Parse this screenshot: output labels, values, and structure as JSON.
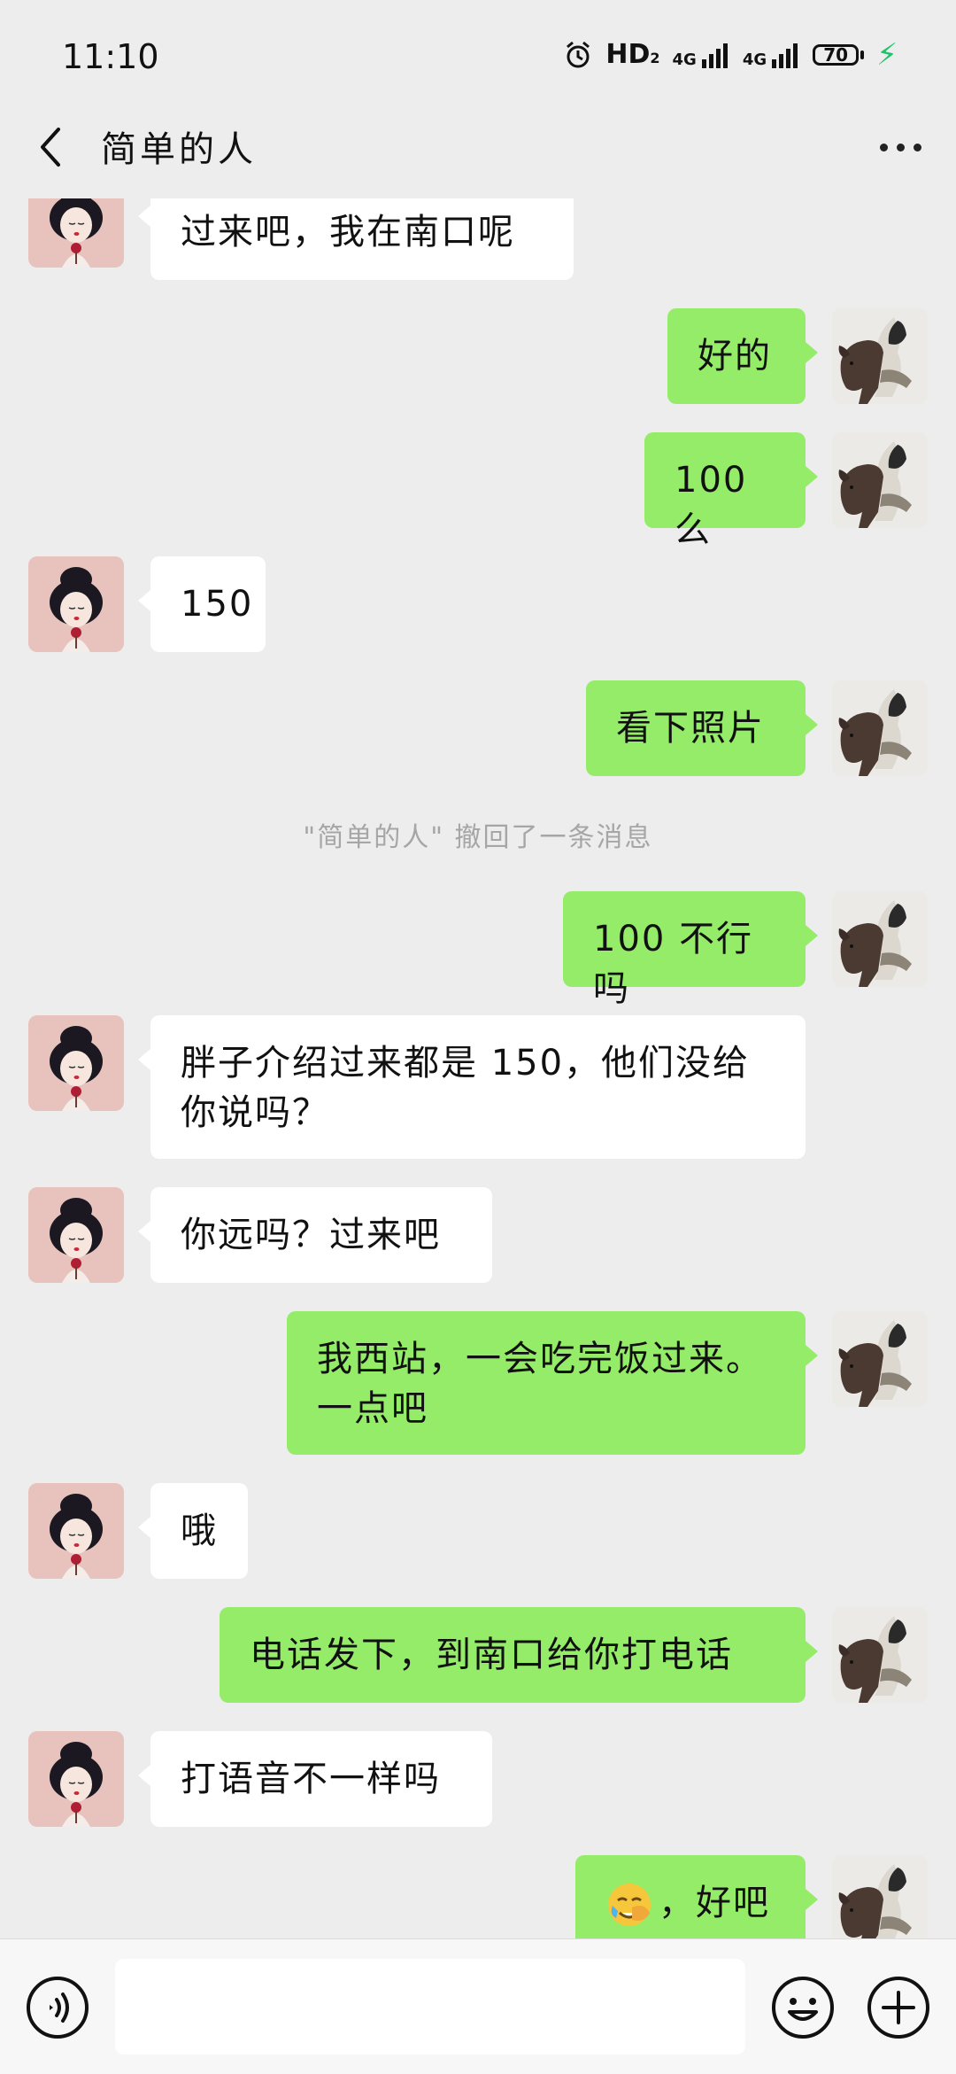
{
  "status_bar": {
    "time": "11:10",
    "hd_label": "HD",
    "hd_sub": "2",
    "network_1": "4G",
    "network_2": "4G",
    "battery_level": "70",
    "charging": true,
    "icons": [
      "alarm-icon",
      "signal-icon",
      "battery-icon",
      "charge-icon"
    ]
  },
  "header": {
    "title": "简单的人",
    "back_icon": "chevron-left-icon",
    "more_icon": "more-dots-icon"
  },
  "messages": [
    {
      "side": "in",
      "text": "过来吧，我在南口呢"
    },
    {
      "side": "out",
      "text": "好的"
    },
    {
      "side": "out",
      "text": "100 么"
    },
    {
      "side": "in",
      "text": "150"
    },
    {
      "side": "out",
      "text": "看下照片"
    },
    {
      "side": "system",
      "text": "\"简单的人\" 撤回了一条消息"
    },
    {
      "side": "out",
      "text": "100 不行吗"
    },
    {
      "side": "in",
      "line1": "胖子介绍过来都是 150，他们没给",
      "line2": "你说吗？"
    },
    {
      "side": "in",
      "text": "你远吗？过来吧"
    },
    {
      "side": "out",
      "line1": "我西站，一会吃完饭过来。",
      "line2": "一点吧"
    },
    {
      "side": "in",
      "text": "哦"
    },
    {
      "side": "out",
      "text": "电话发下，到南口给你打电话"
    },
    {
      "side": "in",
      "text": "打语音不一样吗"
    },
    {
      "side": "out",
      "emoji": "facepalm-crying-emoji",
      "text": "，好吧"
    }
  ],
  "input_bar": {
    "text_value": "",
    "icons": [
      "voice-icon",
      "emoji-face-icon",
      "plus-icon"
    ]
  },
  "colors": {
    "background": "#ededed",
    "bubble_out": "#95ec69",
    "bubble_in": "#ffffff",
    "system_text": "#a6a6a6",
    "charge": "#1ec36b"
  }
}
